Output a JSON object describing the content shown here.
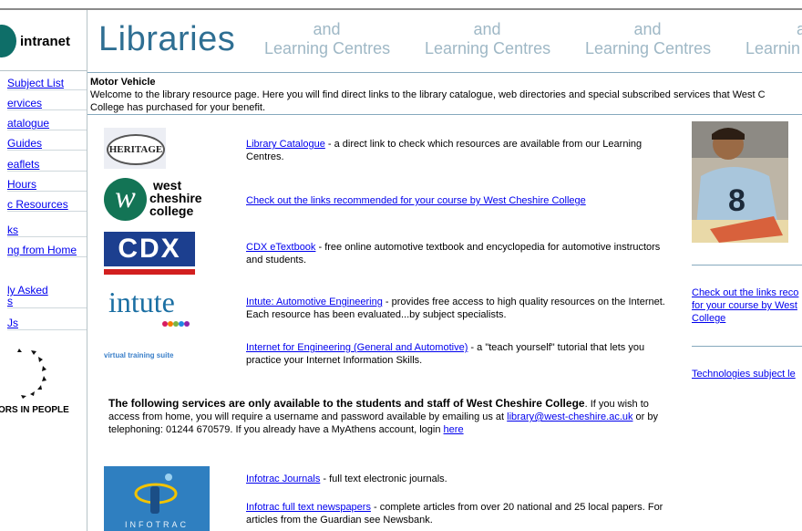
{
  "brand": {
    "intranet_label": "intranet"
  },
  "header": {
    "title": "Libraries",
    "slogans": [
      {
        "line1": "and",
        "line2": "Learning Centres"
      },
      {
        "line1": "and",
        "line2": "Learning Centres"
      },
      {
        "line1": "and",
        "line2": "Learning Centres"
      },
      {
        "line1": "a",
        "line2": "Learnin"
      }
    ]
  },
  "sidebar": {
    "items": [
      {
        "label": "Subject List"
      },
      {
        "label": "ervices"
      },
      {
        "label": "atalogue"
      },
      {
        "label": "Guides"
      },
      {
        "label": "eaflets"
      },
      {
        "label": "Hours"
      },
      {
        "label": "c Resources"
      },
      {
        "label": "ks"
      },
      {
        "label": "ng from Home"
      },
      {
        "label": "ly Asked"
      },
      {
        "label": "s"
      },
      {
        "label": "Js"
      }
    ],
    "investors_text": "ORS IN PEOPLE"
  },
  "intro": {
    "title": "Motor Vehicle",
    "text1": "Welcome to the library resource page. Here you will find direct links to the library catalogue, web directories and special subscribed services that West C",
    "text2": "College has purchased for your benefit."
  },
  "logos": {
    "heritage": "HERITAGE",
    "wcc_line1": "west",
    "wcc_line2": "cheshire",
    "wcc_line3": "college",
    "cdx": "CDX",
    "intute": "intute",
    "vts": "virtual training suite",
    "infotrac": "INFOTRAC"
  },
  "resources": [
    {
      "link": "Library Catalogue",
      "desc": " - a direct link to check which resources are available from our Learning Centres."
    },
    {
      "link": "Check out the links recommended for your course by West Cheshire College",
      "desc": ""
    },
    {
      "link": "CDX eTextbook",
      "desc": " - free online automotive textbook and encyclopedia for automotive instructors and students."
    },
    {
      "link": "Intute: Automotive Engineering",
      "desc": " - provides free access to high quality resources on the Internet. Each resource has been evaluated...by subject specialists."
    },
    {
      "link": "Internet for Engineering (General and Automotive)",
      "desc": " - a \"teach yourself\" tutorial that lets you practice your Internet Information Skills."
    }
  ],
  "services": {
    "bold": "The following services are only available to the students and staff of West Cheshire College",
    "text1": ". If you wish to access from home, you will require a username and password available by emailing us at ",
    "email": "library@west-cheshire.ac.uk",
    "text2": " or by telephoning: 01244 670579. If you already have a MyAthens account, login ",
    "here": "here"
  },
  "infotrac": [
    {
      "link": "Infotrac Journals",
      "desc": " - full text electronic journals."
    },
    {
      "link": "Infotrac full text newspapers",
      "desc": " - complete articles from over 20 national and 25 local papers. For articles from the Guardian see Newsbank."
    }
  ],
  "right": {
    "link1_l1": "Check out the links reco",
    "link1_l2": "for your course by West",
    "link1_l3": "College",
    "link2": "Technologies subject le"
  }
}
